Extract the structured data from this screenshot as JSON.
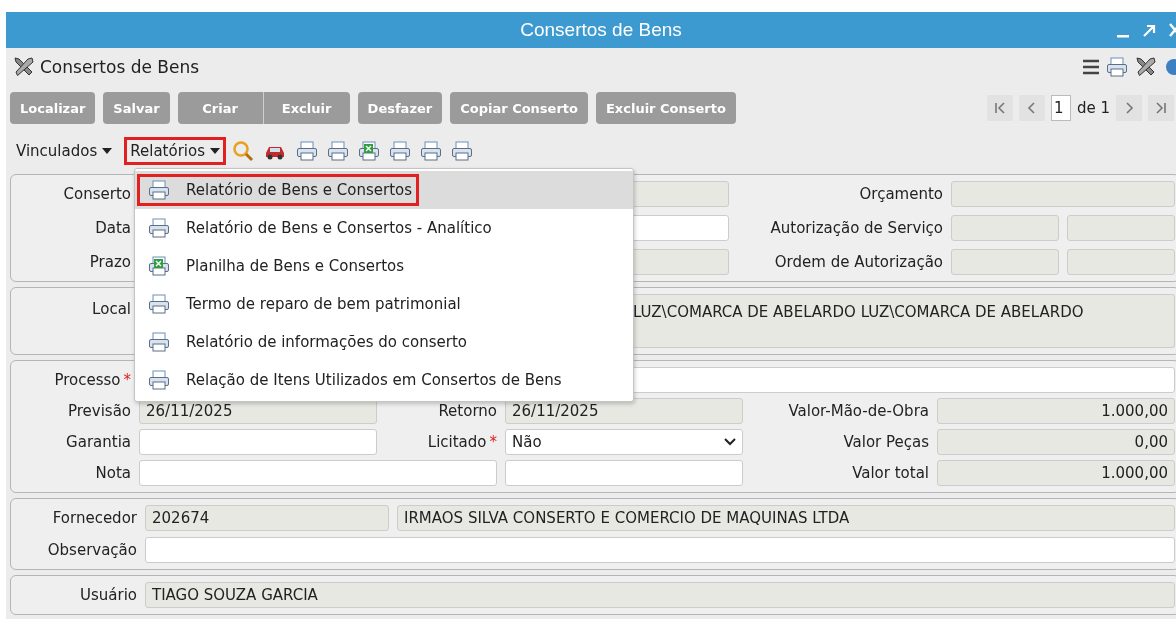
{
  "window": {
    "title": "Consertos de Bens"
  },
  "header": {
    "title": "Consertos de Bens"
  },
  "buttons": [
    {
      "label": "Localizar",
      "joined_with_next": false
    },
    {
      "label": "Salvar",
      "joined_with_next": false
    },
    {
      "label": "Criar",
      "joined_with_next": true
    },
    {
      "label": "Excluir",
      "joined_with_next": false
    },
    {
      "label": "Desfazer",
      "joined_with_next": false
    },
    {
      "label": "Copiar Conserto",
      "joined_with_next": false
    },
    {
      "label": "Excluir Conserto",
      "joined_with_next": false
    }
  ],
  "pager": {
    "page": "1",
    "of": "de 1"
  },
  "toolbar": {
    "menus": [
      {
        "label": "Vinculados",
        "highlighted": false
      },
      {
        "label": "Relatórios",
        "highlighted": true
      }
    ],
    "icons": [
      {
        "kind": "search"
      },
      {
        "kind": "car"
      },
      {
        "kind": "printer"
      },
      {
        "kind": "printer"
      },
      {
        "kind": "spreadsheet"
      },
      {
        "kind": "printer"
      },
      {
        "kind": "printer"
      },
      {
        "kind": "printer"
      }
    ]
  },
  "dropdown": {
    "items": [
      {
        "label": "Relatório de Bens e Consertos",
        "kind": "printer",
        "selected": true
      },
      {
        "label": "Relatório de Bens e Consertos - Analítico",
        "kind": "printer",
        "selected": false
      },
      {
        "label": "Planilha de Bens e Consertos",
        "kind": "spreadsheet",
        "selected": false
      },
      {
        "label": "Termo de reparo de bem patrimonial",
        "kind": "printer",
        "selected": false
      },
      {
        "label": "Relatório de informações do conserto",
        "kind": "printer",
        "selected": false
      },
      {
        "label": "Relação de Itens Utilizados em Consertos de Bens",
        "kind": "printer",
        "selected": false
      }
    ]
  },
  "sections": [
    {
      "kind": "identification",
      "rows": [
        [
          {
            "label": "Conserto",
            "fields": [
              {
                "readonly": true
              }
            ]
          },
          {
            "label": "Orçamento",
            "fields": [
              {
                "readonly": true
              }
            ]
          }
        ],
        [
          {
            "label": "Data",
            "fields": [
              {
                "readonly": false
              }
            ]
          },
          {
            "label": "Autorização de Serviço",
            "fields": [
              {
                "readonly": true
              },
              {
                "readonly": true
              }
            ]
          }
        ],
        [
          {
            "label": "Prazo",
            "fields": [
              {
                "readonly": true
              }
            ]
          },
          {
            "label": "Ordem de Autorização",
            "fields": [
              {
                "readonly": true
              },
              {
                "readonly": true
              }
            ]
          }
        ]
      ]
    },
    {
      "kind": "location",
      "rows": [
        [
          {
            "label": "Local",
            "fields": [
              {
                "readonly": true,
                "value": "LUZ\\COMARCA DE ABELARDO LUZ\\COMARCA DE ABELARDO"
              }
            ]
          }
        ]
      ]
    },
    {
      "kind": "process",
      "rows": [
        [
          {
            "label": "Processo",
            "required_mark": "*",
            "fields": [
              {
                "readonly": false
              }
            ]
          }
        ],
        [
          {
            "label": "Previsão",
            "fields": [
              {
                "readonly": true,
                "value": "26/11/2025"
              }
            ]
          },
          {
            "label": "Retorno",
            "fields": [
              {
                "readonly": true,
                "value": "26/11/2025"
              }
            ]
          },
          {
            "label": "Valor-Mão-de-Obra",
            "fields": [
              {
                "readonly": true,
                "value": "1.000,00",
                "numeric": true
              }
            ]
          }
        ],
        [
          {
            "label": "Garantia",
            "fields": [
              {
                "readonly": false
              }
            ]
          },
          {
            "label": "Licitado",
            "required_mark": "*",
            "fields": [
              {
                "readonly": false,
                "kind": "select",
                "value": "Não"
              }
            ]
          },
          {
            "label": "Valor Peças",
            "fields": [
              {
                "readonly": true,
                "value": "0,00",
                "numeric": true
              }
            ]
          }
        ],
        [
          {
            "label": "Nota",
            "fields": [
              {
                "readonly": false
              }
            ]
          },
          {
            "fields": [
              {
                "readonly": false
              }
            ]
          },
          {
            "label": "Valor total",
            "fields": [
              {
                "readonly": true,
                "value": "1.000,00",
                "numeric": true
              }
            ]
          }
        ]
      ]
    },
    {
      "kind": "supplier",
      "rows": [
        [
          {
            "label": "Fornecedor",
            "fields": [
              {
                "readonly": true,
                "value": "202674"
              },
              {
                "readonly": true,
                "value": "IRMAOS SILVA CONSERTO E COMERCIO DE MAQUINAS LTDA"
              }
            ]
          }
        ],
        [
          {
            "label": "Observação",
            "fields": [
              {
                "readonly": false
              }
            ]
          }
        ]
      ]
    },
    {
      "kind": "user",
      "rows": [
        [
          {
            "label": "Usuário",
            "fields": [
              {
                "readonly": true,
                "value": "TIAGO SOUZA GARCIA"
              }
            ]
          }
        ]
      ]
    }
  ]
}
